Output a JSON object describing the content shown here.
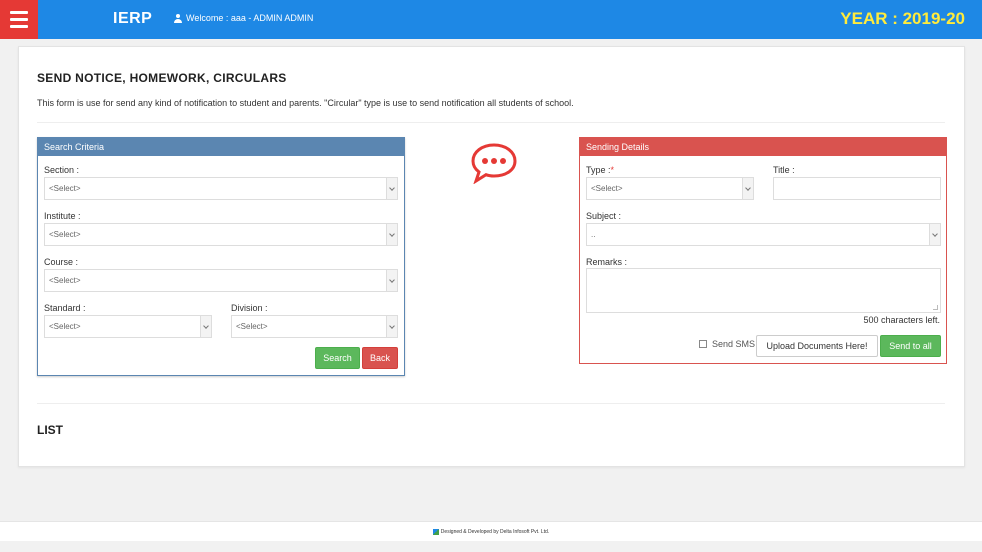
{
  "header": {
    "brand": "IERP",
    "welcome": "Welcome :  aaa - ADMIN ADMIN",
    "year": "YEAR : 2019-20"
  },
  "page": {
    "title": "SEND NOTICE, HOMEWORK, CIRCULARS",
    "description": "This form is use for send any kind of notification to student and parents. \"Circular\" type is use to send notification all students of school.",
    "list_title": "LIST"
  },
  "search_panel": {
    "heading": "Search Criteria",
    "section_label": "Section :",
    "section_value": "<Select>",
    "institute_label": "Institute :",
    "institute_value": "<Select>",
    "course_label": "Course :",
    "course_value": "<Select>",
    "standard_label": "Standard :",
    "standard_value": "<Select>",
    "division_label": "Division :",
    "division_value": "<Select>",
    "search_button": "Search",
    "back_button": "Back"
  },
  "send_panel": {
    "heading": "Sending Details",
    "type_label": "Type :",
    "type_required": "*",
    "type_value": "<Select>",
    "title_label": "Title :",
    "title_value": "",
    "subject_label": "Subject :",
    "subject_value": "..",
    "remarks_label": "Remarks :",
    "remarks_value": "",
    "chars_left": "500 characters left.",
    "send_sms_label": "Send SMS",
    "upload_button": "Upload Documents Here!",
    "send_button": "Send to all"
  },
  "footer": {
    "text": "Designed & Developed by Delta Infosoft Pvt. Ltd."
  },
  "colors": {
    "topbar": "#1e88e5",
    "menu": "#e53935",
    "year": "#ffeb3b",
    "search_panel": "#5b86b1",
    "send_panel": "#d9534f",
    "success": "#5cb85c",
    "danger": "#d9534f"
  }
}
